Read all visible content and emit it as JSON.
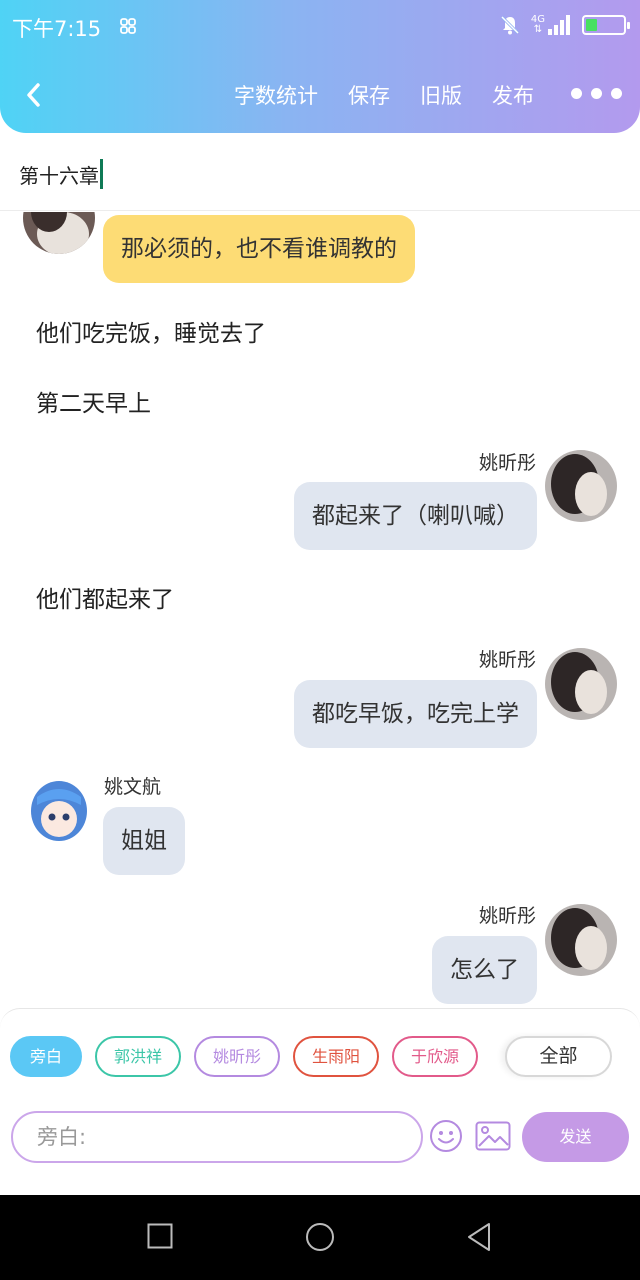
{
  "status_bar": {
    "time": "下午7:15",
    "network": "4G",
    "battery_level": 0.3
  },
  "header": {
    "back_icon": "chevron-left-icon",
    "actions": {
      "word_count": "字数统计",
      "save": "保存",
      "old_version": "旧版",
      "publish": "发布"
    },
    "more_icon": "more-horizontal-icon"
  },
  "chapter": {
    "title": "第十六章"
  },
  "chat": {
    "msg1": {
      "text": "那必须的，也不看谁调教的"
    },
    "narr1": "他们吃完饭，睡觉去了",
    "narr2": "第二天早上",
    "msg2": {
      "speaker": "姚昕彤",
      "text": "都起来了（喇叭喊）"
    },
    "narr3": "他们都起来了",
    "msg3": {
      "speaker": "姚昕彤",
      "text": "都吃早饭，吃完上学"
    },
    "msg4": {
      "speaker": "姚文航",
      "text": "姐姐"
    },
    "msg5": {
      "speaker": "姚昕彤",
      "text": "怎么了"
    }
  },
  "composer": {
    "chips": [
      {
        "label": "旁白",
        "color": "#5bc8f5",
        "active": true
      },
      {
        "label": "郭洪祥",
        "color": "#3cc6a8"
      },
      {
        "label": "姚昕彤",
        "color": "#b48ae0"
      },
      {
        "label": "生雨阳",
        "color": "#e0533f"
      },
      {
        "label": "于欣源",
        "color": "#e25a8a"
      }
    ],
    "all_label": "全部",
    "input_placeholder": "旁白:",
    "send_label": "发送"
  }
}
